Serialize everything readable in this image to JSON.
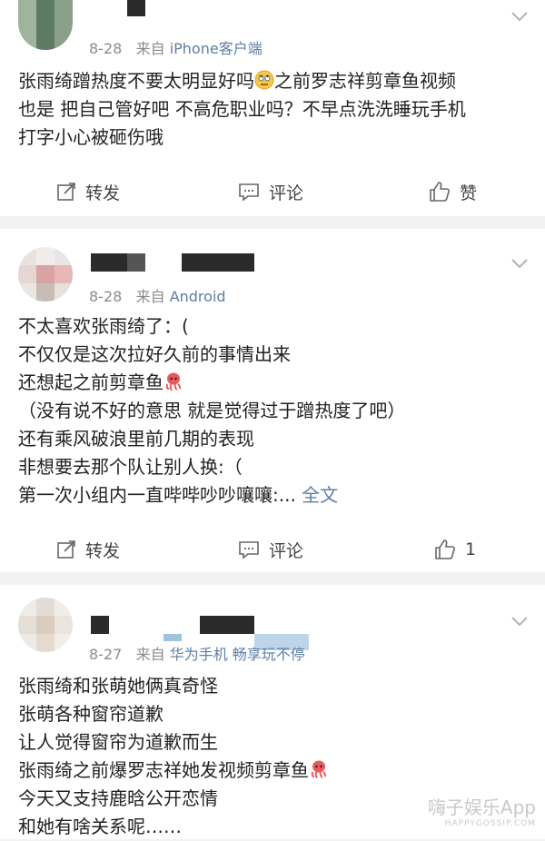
{
  "posts": [
    {
      "date": "8-28",
      "from_label": "来自",
      "source": "iPhone客户端",
      "lines": [
        "张雨绮蹭热度不要太明显好吗",
        "之前罗志祥剪章鱼视频",
        "也是 把自己管好吧 不高危职业吗？不早点洗洗睡玩手机",
        "打字小心被砸伤哦"
      ],
      "actions": {
        "repost": "转发",
        "comment": "评论",
        "like": "赞"
      }
    },
    {
      "date": "8-28",
      "from_label": "来自",
      "source": "Android",
      "lines": [
        "不太喜欢张雨绮了：(",
        "不仅仅是这次拉好久前的事情出来",
        "还想起之前剪章鱼",
        "（没有说不好的意思 就是觉得过于蹭热度了吧）",
        "还有乘风破浪里前几期的表现",
        "非想要去那个队让别人换:（",
        "第一次小组内一直哔哔吵吵嚷嚷:..."
      ],
      "more_label": "全文",
      "actions": {
        "repost": "转发",
        "comment": "评论",
        "like": "1"
      }
    },
    {
      "date": "8-27",
      "from_label": "来自",
      "source": "华为手机 畅享玩不停",
      "lines": [
        "张雨绮和张萌她俩真奇怪",
        "张萌各种窗帘道歉",
        "让人觉得窗帘为道歉而生",
        "张雨绮之前爆罗志祥她发视频剪章鱼",
        "今天又支持鹿晗公开恋情",
        "和她有啥关系呢……"
      ]
    }
  ],
  "watermark": {
    "main": "嗨子娱乐App",
    "sub": "HAPPYGOSSIP.COM"
  },
  "colors": {
    "link": "#5b7fa6",
    "meta": "#8c8c8c",
    "divider": "#f2f2f2"
  }
}
